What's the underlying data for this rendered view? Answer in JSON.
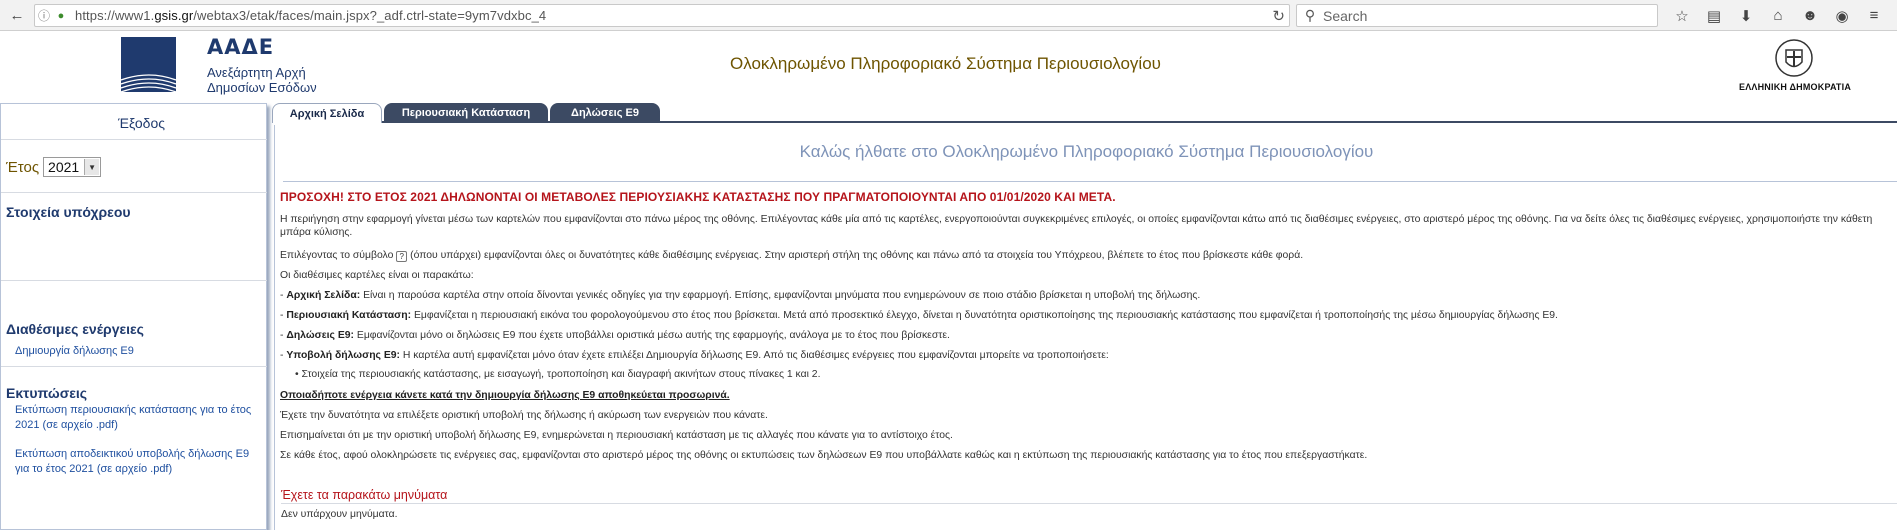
{
  "browser": {
    "url_prefix": "https://www1.",
    "url_domain": "gsis.gr",
    "url_path": "/webtax3/etak/faces/main.jspx?_adf.ctrl-state=9ym7vdxbc_4",
    "search_placeholder": "Search"
  },
  "header": {
    "org_acronym": "ΑΑΔΕ",
    "org_line1": "Ανεξάρτητη Αρχή",
    "org_line2": "Δημοσίων Εσόδων",
    "system_title": "Ολοκληρωμένο Πληροφοριακό Σύστημα Περιουσιολογίου",
    "republic_label": "ΕΛΛΗΝΙΚΗ ΔΗΜΟΚΡΑΤΙΑ"
  },
  "sidebar": {
    "exit_label": "Έξοδος",
    "year_label": "Έτος",
    "year_value": "2021",
    "taxpayer_heading": "Στοιχεία υπόχρεου",
    "actions_heading": "Διαθέσιμες ενέργειες",
    "actions": [
      {
        "label": "Δημιουργία δήλωσης Ε9"
      }
    ],
    "prints_heading": "Εκτυπώσεις",
    "prints": [
      {
        "label": "Εκτύπωση περιουσιακής κατάστασης για το έτος 2021 (σε αρχείο .pdf)"
      },
      {
        "label": "Εκτύπωση αποδεικτικού υποβολής δήλωσης Ε9 για το έτος 2021 (σε αρχείο .pdf)"
      }
    ]
  },
  "tabs": [
    {
      "label": "Αρχική Σελίδα",
      "active": true
    },
    {
      "label": "Περιουσιακή Κατάσταση",
      "active": false
    },
    {
      "label": "Δηλώσεις Ε9",
      "active": false
    }
  ],
  "main": {
    "welcome": "Καλώς ήλθατε στο Ολοκληρωμένο Πληροφοριακό Σύστημα Περιουσιολογίου",
    "warning": "ΠΡΟΣΟΧΗ! ΣΤΟ ΕΤΟΣ 2021 ΔΗΛΩΝΟΝΤΑΙ ΟΙ ΜΕΤΑΒΟΛΕΣ ΠΕΡΙΟΥΣΙΑΚΗΣ ΚΑΤΑΣΤΑΣΗΣ ΠΟΥ ΠΡΑΓΜΑΤΟΠΟΙΟΥΝΤΑΙ ΑΠΟ 01/01/2020 ΚΑΙ ΜΕΤΑ.",
    "intro": "Η περιήγηση στην εφαρμογή γίνεται μέσω των καρτελών που εμφανίζονται στο πάνω μέρος της οθόνης. Επιλέγοντας κάθε μία από τις καρτέλες, ενεργοποιούνται συγκεκριμένες επιλογές, οι οποίες εμφανίζονται κάτω από τις διαθέσιμες ενέργειες, στο αριστερό μέρος της οθόνης. Για να δείτε όλες τις διαθέσιμες ενέργειες, χρησιμοποιήστε την κάθετη μπάρα κύλισης.",
    "symbol_before": "Επιλέγοντας το σύμβολο",
    "symbol_glyph": "?",
    "symbol_after": "(όπου υπάρχει) εμφανίζονται όλες οι δυνατότητες κάθε διαθέσιμης ενέργειας. Στην αριστερή στήλη της οθόνης και πάνω από τα στοιχεία του Υπόχρεου, βλέπετε το έτος που βρίσκεστε κάθε φορά.",
    "tabs_intro": "Οι διαθέσιμες καρτέλες είναι οι παρακάτω:",
    "tab_desc": [
      {
        "name": "Αρχική Σελίδα:",
        "text": "Είναι η παρούσα καρτέλα στην οποία δίνονται γενικές οδηγίες για την εφαρμογή. Επίσης, εμφανίζονται μηνύματα που ενημερώνουν σε ποιο στάδιο βρίσκεται η υποβολή της δήλωσης."
      },
      {
        "name": "Περιουσιακή Κατάσταση:",
        "text": "Εμφανίζεται η περιουσιακή εικόνα του φορολογούμενου στο έτος που βρίσκεται. Μετά από προσεκτικό έλεγχο, δίνεται η δυνατότητα οριστικοποίησης της περιουσιακής κατάστασης που εμφανίζεται ή τροποποίησής της μέσω δημιουργίας δήλωσης Ε9."
      },
      {
        "name": "Δηλώσεις Ε9:",
        "text": "Εμφανίζονται μόνο οι δηλώσεις Ε9 που έχετε υποβάλλει οριστικά μέσω αυτής της εφαρμογής, ανάλογα με το έτος που βρίσκεστε."
      },
      {
        "name": "Υποβολή δήλωσης Ε9:",
        "text": "Η καρτέλα αυτή εμφανίζεται μόνο όταν έχετε επιλέξει Δημιουργία δήλωσης Ε9. Από τις διαθέσιμες ενέργειες που εμφανίζονται μπορείτε να τροποποιήσετε:"
      }
    ],
    "bullet": "Στοιχεία της περιουσιακής κατάστασης, με εισαγωγή, τροποποίηση και διαγραφή ακινήτων στους πίνακες 1 και 2.",
    "save_note": "Οποιαδήποτε ενέργεια κάνετε κατά την δημιουργία δήλωσης Ε9 αποθηκεύεται προσωρινά.",
    "para_final_submit": "Έχετε την δυνατότητα να επιλέξετε οριστική υποβολή της δήλωσης ή ακύρωση των ενεργειών που κάνατε.",
    "para_update": "Επισημαίνεται ότι με την οριστική υποβολή δήλωσης Ε9, ενημερώνεται η περιουσιακή κατάσταση με τις αλλαγές που κάνατε για το αντίστοιχο έτος.",
    "para_prints": "Σε κάθε έτος, αφού ολοκληρώσετε τις ενέργειες σας, εμφανίζονται στο αριστερό μέρος της οθόνης οι εκτυπώσεις των δηλώσεων Ε9 που υποβάλλατε καθώς και η εκτύπωση της περιουσιακής κατάστασης για το έτος που επεξεργαστήκατε.",
    "messages_heading": "Έχετε τα παρακάτω μηνύματα",
    "messages_none": "Δεν υπάρχουν μηνύματα."
  }
}
